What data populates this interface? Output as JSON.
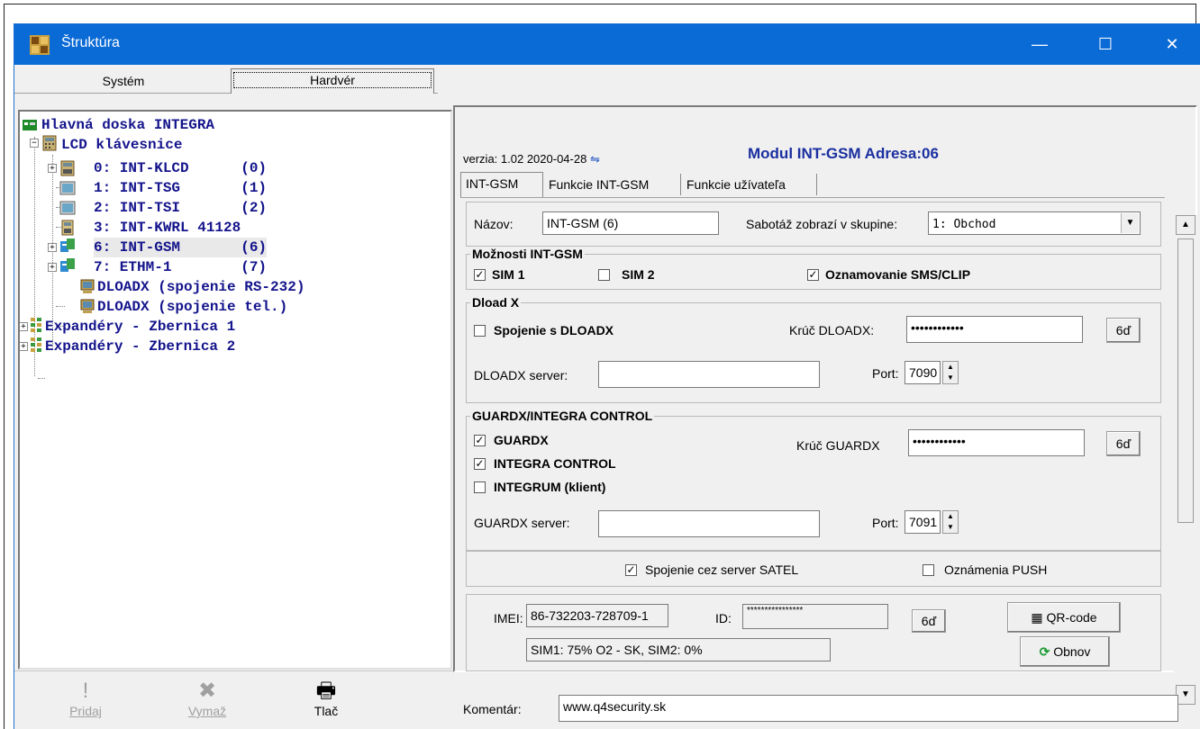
{
  "window": {
    "title": "Štruktúra",
    "min": "—",
    "max": "☐",
    "close": "✕"
  },
  "left_tabs": {
    "system": "Systém",
    "hardware": "Hardvér"
  },
  "tree": {
    "root": "Hlavná doska INTEGRA",
    "lcd_group": "LCD klávesnice",
    "items": [
      "0: INT-KLCD      (0)",
      "1: INT-TSG       (1)",
      "2: INT-TSI       (2)",
      "3: INT-KWRL 41128",
      "6: INT-GSM       (6)",
      "7: ETHM-1        (7)"
    ],
    "dloadx_rs": "DLOADX (spojenie RS-232)",
    "dloadx_tel": "DLOADX (spojenie tel.)",
    "exp1": "Expandéry - Zbernica 1",
    "exp2": "Expandéry - Zbernica 2"
  },
  "bottom_buttons": {
    "add": "Pridaj",
    "delete": "Vymaž",
    "print": "Tlač"
  },
  "header": {
    "version": "verzia: 1.02 2020-04-28",
    "module_title": "Modul INT-GSM Adresa:06"
  },
  "tabs": [
    "INT-GSM",
    "Funkcie INT-GSM",
    "Funkcie užívateľa"
  ],
  "form": {
    "name_label": "Názov:",
    "name_value": "INT-GSM    (6)",
    "tamper_label": "Sabotáž zobrazí v skupine:",
    "tamper_value": "1: Obchod",
    "options_title": "Možnosti INT-GSM",
    "sim1": "SIM 1",
    "sim2": "SIM 2",
    "sms_clip": "Oznamovanie SMS/CLIP",
    "dload_title": "Dload X",
    "dload_conn": "Spojenie s DLOADX",
    "dload_key_label": "Krúč DLOADX:",
    "dload_key_value": "••••••••••••",
    "dload_server_label": "DLOADX server:",
    "dload_server_value": "",
    "port_label": "Port:",
    "dload_port": "7090",
    "guard_title": "GUARDX/INTEGRA CONTROL",
    "guardx": "GUARDX",
    "integra_control": "INTEGRA CONTROL",
    "integrum": "INTEGRUM (klient)",
    "guard_key_label": "Krúč GUARDX",
    "guard_key_value": "••••••••••••",
    "guard_server_label": "GUARDX server:",
    "guard_server_value": "",
    "guard_port": "7091",
    "satel": "Spojenie cez server SATEL",
    "push": "Oznámenia PUSH",
    "imei_label": "IMEI:",
    "imei_value": "86-732203-728709-1",
    "id_label": "ID:",
    "id_value": "****************",
    "key_button": "6ď",
    "qr_button": "QR-code",
    "sim_status": "SIM1:  75% O2 - SK, SIM2:  0%",
    "refresh_button": "Obnov"
  },
  "comment": {
    "label": "Komentár:",
    "value": "www.q4security.sk"
  },
  "colors": {
    "titlebar": "#0a6ad6",
    "tree_text": "#14148c",
    "module_title": "#1a2fa0"
  }
}
